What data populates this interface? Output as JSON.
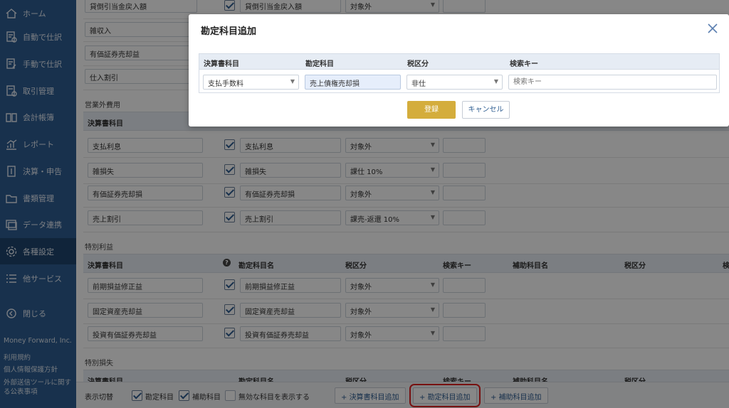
{
  "sidebar": {
    "items": [
      {
        "label": "ホーム",
        "icon": "home-icon"
      },
      {
        "label": "自動で仕訳",
        "icon": "auto-journal-icon"
      },
      {
        "label": "手動で仕訳",
        "icon": "manual-journal-icon"
      },
      {
        "label": "取引管理",
        "icon": "transaction-icon"
      },
      {
        "label": "会計帳簿",
        "icon": "ledger-icon"
      },
      {
        "label": "レポート",
        "icon": "report-icon"
      },
      {
        "label": "決算・申告",
        "icon": "settlement-icon"
      },
      {
        "label": "書類管理",
        "icon": "folder-icon"
      },
      {
        "label": "データ連携",
        "icon": "data-link-icon"
      },
      {
        "label": "各種設定",
        "icon": "gear-icon",
        "active": true
      },
      {
        "label": "他サービス",
        "icon": "list-icon"
      }
    ],
    "close_label": "閉じる",
    "company": "Money Forward, Inc.",
    "links": [
      "利用規約",
      "個人情報保護方針",
      "外部送信ツールに関する公表事項"
    ]
  },
  "main": {
    "top_rows": [
      {
        "account": "貸倒引当金戻入額",
        "name": "貸倒引当金戻入額",
        "tax": "対象外"
      },
      {
        "account": "雑収入"
      },
      {
        "account": "有価証券売却益"
      },
      {
        "account": "仕入割引"
      }
    ],
    "nonop_section": "営業外費用",
    "nonop_header_first": "決算書科目",
    "nonop_rows": [
      {
        "account": "支払利息",
        "name": "支払利息",
        "tax": "対象外"
      },
      {
        "account": "雑損失",
        "name": "雑損失",
        "tax": "課仕 10%"
      },
      {
        "account": "有価証券売却損",
        "name": "有価証券売却損",
        "tax": "対象外"
      },
      {
        "account": "売上割引",
        "name": "売上割引",
        "tax": "課売-返還 10%"
      }
    ],
    "special_section": "特別利益",
    "columns": [
      "決算書科目",
      "勘定科目名",
      "税区分",
      "検索キー",
      "補助科目名",
      "税区分",
      "検"
    ],
    "special_rows": [
      {
        "account": "前期損益修正益",
        "name": "前期損益修正益",
        "tax": "対象外"
      },
      {
        "account": "固定資産売却益",
        "name": "固定資産売却益",
        "tax": "対象外"
      },
      {
        "account": "投資有価証券売却益",
        "name": "投資有価証券売却益",
        "tax": "対象外"
      }
    ],
    "loss_section": "特別損失"
  },
  "bottom": {
    "toggle_label": "表示切替",
    "chk_account": "勘定科目",
    "chk_sub": "補助科目",
    "chk_invalid": "無効な科目を表示する",
    "btn_add_statement": "決算書科目追加",
    "btn_add_account": "勘定科目追加",
    "btn_add_sub": "補助科目追加"
  },
  "modal": {
    "title": "勘定科目追加",
    "headers": [
      "決算書科目",
      "勘定科目",
      "税区分",
      "検索キー"
    ],
    "statement_value": "支払手数料",
    "account_value": "売上債権売却損",
    "tax_value": "非仕",
    "search_placeholder": "検索キー",
    "submit_label": "登録",
    "cancel_label": "キャンセル"
  },
  "colors": {
    "sidebar": "#2e5d91",
    "primary_button": "#d4ad3c",
    "highlight": "#e02020"
  }
}
